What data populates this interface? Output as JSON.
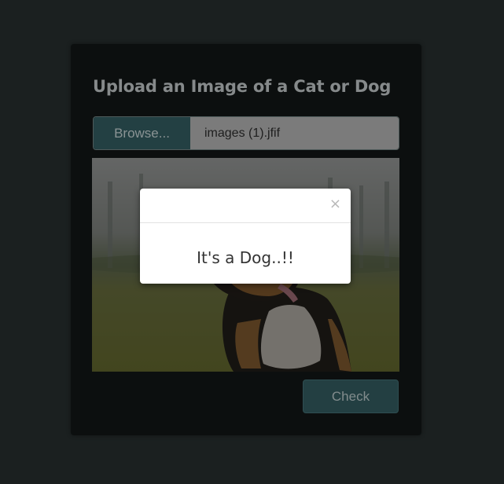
{
  "colors": {
    "page_bg": "#1b2020",
    "card_bg": "#0c0f0f",
    "button_bg": "#234043",
    "file_field_bg": "#7b7b7b",
    "modal_bg": "#ffffff"
  },
  "upload_card": {
    "title": "Upload an Image of a Cat or Dog",
    "file_input": {
      "browse_label": "Browse...",
      "file_name": "images (1).jfif"
    },
    "image_preview": {
      "subject": "dog"
    },
    "check_label": "Check"
  },
  "result_modal": {
    "close_glyph": "×",
    "message": "It's a Dog..!!"
  }
}
